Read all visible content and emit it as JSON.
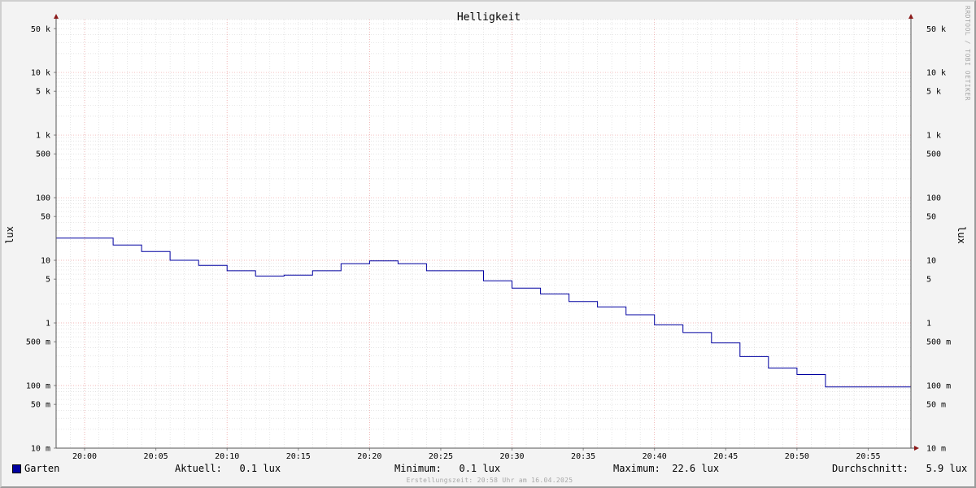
{
  "chart_data": {
    "type": "line",
    "title": "Helligkeit",
    "ylabel_left": "lux",
    "ylabel_right": "lux",
    "y_scale": "log",
    "ylim": [
      0.01,
      70000
    ],
    "y_ticks": [
      {
        "value": 0.01,
        "label": "10 m"
      },
      {
        "value": 0.05,
        "label": "50 m"
      },
      {
        "value": 0.1,
        "label": "100 m"
      },
      {
        "value": 0.5,
        "label": "500 m"
      },
      {
        "value": 1,
        "label": "1"
      },
      {
        "value": 5,
        "label": "5"
      },
      {
        "value": 10,
        "label": "10"
      },
      {
        "value": 50,
        "label": "50"
      },
      {
        "value": 100,
        "label": "100"
      },
      {
        "value": 500,
        "label": "500"
      },
      {
        "value": 1000,
        "label": "1 k"
      },
      {
        "value": 5000,
        "label": "5 k"
      },
      {
        "value": 10000,
        "label": "10 k"
      },
      {
        "value": 50000,
        "label": "50 k"
      }
    ],
    "xlim": [
      "19:58",
      "20:58"
    ],
    "x_ticks": [
      "20:00",
      "20:05",
      "20:10",
      "20:15",
      "20:20",
      "20:25",
      "20:30",
      "20:35",
      "20:40",
      "20:45",
      "20:50",
      "20:55"
    ],
    "grid": true,
    "series": [
      {
        "name": "Garten",
        "color": "#0000a0",
        "step": true,
        "x": [
          "19:58",
          "20:02",
          "20:04",
          "20:06",
          "20:08",
          "20:10",
          "20:12",
          "20:14",
          "20:16",
          "20:18",
          "20:20",
          "20:22",
          "20:24",
          "20:26",
          "20:28",
          "20:30",
          "20:32",
          "20:34",
          "20:36",
          "20:38",
          "20:40",
          "20:42",
          "20:44",
          "20:46",
          "20:48",
          "20:50",
          "20:52",
          "20:58"
        ],
        "y": [
          22.6,
          17.5,
          13.8,
          10.0,
          8.3,
          6.8,
          5.6,
          5.8,
          6.8,
          8.8,
          9.8,
          8.8,
          6.8,
          6.8,
          4.7,
          3.6,
          2.9,
          2.2,
          1.8,
          1.35,
          0.93,
          0.7,
          0.48,
          0.29,
          0.19,
          0.15,
          0.095,
          0.095
        ]
      }
    ]
  },
  "watermark": "RRDTOOL / TOBI OETIKER",
  "legend": {
    "series_name": "Garten",
    "current": "Aktuell:   0.1 lux",
    "minimum": "Minimum:   0.1 lux",
    "maximum": "Maximum:  22.6 lux",
    "average": "Durchschnitt:   5.9 lux"
  },
  "footer": "Erstellungszeit: 20:58 Uhr am 16.04.2025"
}
